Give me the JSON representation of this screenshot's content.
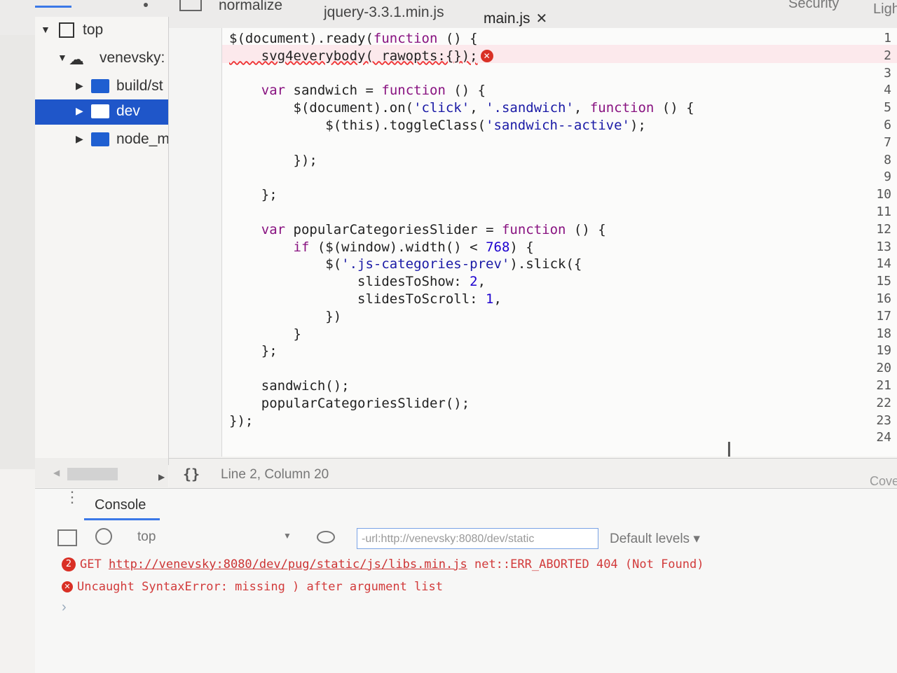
{
  "tabs": [
    {
      "label": "normalize"
    },
    {
      "label": "jquery-3.3.1.min.js"
    },
    {
      "label": "main.js",
      "active": true
    }
  ],
  "panel_tabs": {
    "security": "Security",
    "lighthouse_partial": "Ligh"
  },
  "navigator": {
    "items": [
      {
        "label": "top"
      },
      {
        "label": "venevsky:"
      },
      {
        "label": "build/st"
      },
      {
        "label": "dev"
      },
      {
        "label": "node_m"
      }
    ]
  },
  "editor": {
    "line_numbers": [
      "1",
      "2",
      "3",
      "4",
      "5",
      "6",
      "7",
      "8",
      "9",
      "10",
      "11",
      "12",
      "13",
      "14",
      "15",
      "16",
      "17",
      "18",
      "19",
      "20",
      "21",
      "22",
      "23",
      "24"
    ],
    "lines": [
      "$(document).ready(function () {",
      "    svg4everybody( rawopts:{});",
      "",
      "    var sandwich = function () {",
      "        $(document).on('click', '.sandwich', function () {",
      "            $(this).toggleClass('sandwich--active');",
      "",
      "        });",
      "",
      "    };",
      "",
      "    var popularCategoriesSlider = function () {",
      "        if ($(window).width() < 768) {",
      "            $('.js-categories-prev').slick({",
      "                slidesToShow: 2,",
      "                slidesToScroll: 1,",
      "            })",
      "        }",
      "    };",
      "",
      "    sandwich();",
      "    popularCategoriesSlider();",
      "});",
      ""
    ]
  },
  "status": {
    "braces": "{}",
    "position": "Line 2, Column 20",
    "coverage_partial": "Cove"
  },
  "drawer": {
    "tab": "Console",
    "context": "top",
    "filter_value": "-url:http://venevsky:8080/dev/static",
    "levels": "Default levels ▾",
    "messages": [
      {
        "count": "2",
        "method": "GET",
        "url": "http://venevsky:8080/dev/pug/static/js/libs.min.js",
        "error": "net::ERR_ABORTED 404 (Not Found)"
      },
      {
        "text": "Uncaught SyntaxError: missing ) after argument list"
      }
    ],
    "prompt": "›"
  }
}
